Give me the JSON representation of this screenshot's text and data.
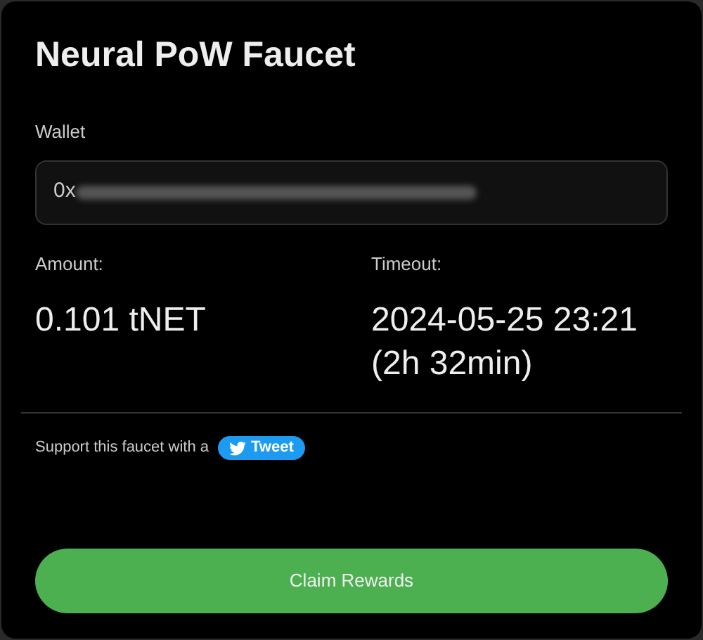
{
  "title": "Neural PoW Faucet",
  "wallet": {
    "label": "Wallet",
    "value": "0x"
  },
  "amount": {
    "label": "Amount:",
    "value": "0.101 tNET"
  },
  "timeout": {
    "label": "Timeout:",
    "value": "2024-05-25 23:21",
    "remaining": "(2h 32min)"
  },
  "support": {
    "text": "Support this faucet with a",
    "button": "Tweet"
  },
  "claim_button": "Claim Rewards"
}
